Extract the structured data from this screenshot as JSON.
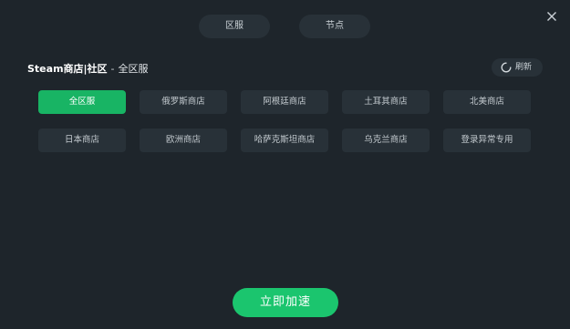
{
  "tabs": [
    {
      "label": "区服"
    },
    {
      "label": "节点"
    }
  ],
  "heading": {
    "store": "Steam商店|社区",
    "separator": "-",
    "region": "全区服"
  },
  "refresh": {
    "label": "刷新"
  },
  "stores": [
    {
      "label": "全区服",
      "active": true
    },
    {
      "label": "俄罗斯商店"
    },
    {
      "label": "阿根廷商店"
    },
    {
      "label": "土耳其商店"
    },
    {
      "label": "北美商店"
    },
    {
      "label": "日本商店"
    },
    {
      "label": "欧洲商店"
    },
    {
      "label": "哈萨克斯坦商店"
    },
    {
      "label": "乌克兰商店"
    },
    {
      "label": "登录异常专用"
    }
  ],
  "start_button": {
    "label": "立即加速"
  },
  "colors": {
    "background": "#1e252b",
    "button": "#283138",
    "accent": "#18b464"
  },
  "icons": {
    "close": "close-icon",
    "refresh": "refresh-spinner-icon"
  }
}
